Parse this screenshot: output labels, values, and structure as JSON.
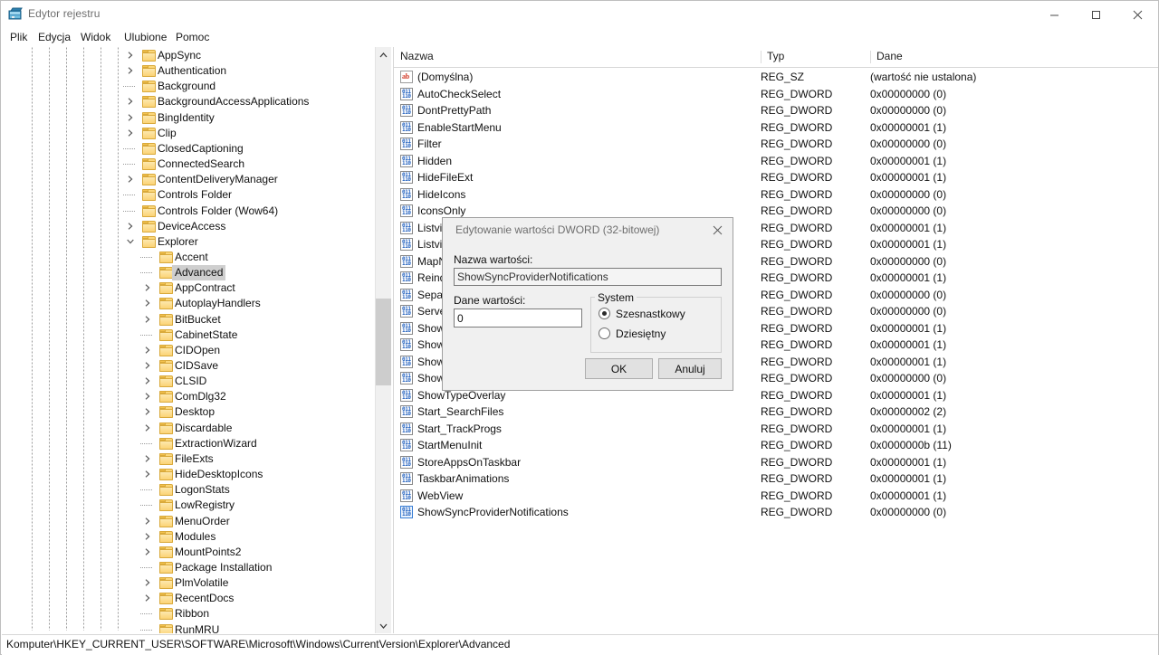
{
  "window": {
    "title": "Edytor rejestru",
    "icon": "registry-editor-icon",
    "minimize": "─",
    "maximize": "□",
    "close": "✕"
  },
  "menu": [
    "Plik",
    "Edycja",
    "Widok",
    "Ulubione",
    "Pomoc"
  ],
  "tree": {
    "items": [
      {
        "label": "AppSync",
        "depth": 5,
        "expander": "collapsed"
      },
      {
        "label": "Authentication",
        "depth": 5,
        "expander": "collapsed"
      },
      {
        "label": "Background",
        "depth": 5,
        "expander": "none"
      },
      {
        "label": "BackgroundAccessApplications",
        "depth": 5,
        "expander": "collapsed"
      },
      {
        "label": "BingIdentity",
        "depth": 5,
        "expander": "collapsed"
      },
      {
        "label": "Clip",
        "depth": 5,
        "expander": "collapsed"
      },
      {
        "label": "ClosedCaptioning",
        "depth": 5,
        "expander": "none"
      },
      {
        "label": "ConnectedSearch",
        "depth": 5,
        "expander": "none"
      },
      {
        "label": "ContentDeliveryManager",
        "depth": 5,
        "expander": "collapsed"
      },
      {
        "label": "Controls Folder",
        "depth": 5,
        "expander": "none"
      },
      {
        "label": "Controls Folder (Wow64)",
        "depth": 5,
        "expander": "none"
      },
      {
        "label": "DeviceAccess",
        "depth": 5,
        "expander": "collapsed"
      },
      {
        "label": "Explorer",
        "depth": 5,
        "expander": "expanded"
      },
      {
        "label": "Accent",
        "depth": 6,
        "expander": "none"
      },
      {
        "label": "Advanced",
        "depth": 6,
        "expander": "none",
        "selected": true
      },
      {
        "label": "AppContract",
        "depth": 6,
        "expander": "collapsed"
      },
      {
        "label": "AutoplayHandlers",
        "depth": 6,
        "expander": "collapsed"
      },
      {
        "label": "BitBucket",
        "depth": 6,
        "expander": "collapsed"
      },
      {
        "label": "CabinetState",
        "depth": 6,
        "expander": "none"
      },
      {
        "label": "CIDOpen",
        "depth": 6,
        "expander": "collapsed"
      },
      {
        "label": "CIDSave",
        "depth": 6,
        "expander": "collapsed"
      },
      {
        "label": "CLSID",
        "depth": 6,
        "expander": "collapsed"
      },
      {
        "label": "ComDlg32",
        "depth": 6,
        "expander": "collapsed"
      },
      {
        "label": "Desktop",
        "depth": 6,
        "expander": "collapsed"
      },
      {
        "label": "Discardable",
        "depth": 6,
        "expander": "collapsed"
      },
      {
        "label": "ExtractionWizard",
        "depth": 6,
        "expander": "none"
      },
      {
        "label": "FileExts",
        "depth": 6,
        "expander": "collapsed"
      },
      {
        "label": "HideDesktopIcons",
        "depth": 6,
        "expander": "collapsed"
      },
      {
        "label": "LogonStats",
        "depth": 6,
        "expander": "none"
      },
      {
        "label": "LowRegistry",
        "depth": 6,
        "expander": "none"
      },
      {
        "label": "MenuOrder",
        "depth": 6,
        "expander": "collapsed"
      },
      {
        "label": "Modules",
        "depth": 6,
        "expander": "collapsed"
      },
      {
        "label": "MountPoints2",
        "depth": 6,
        "expander": "collapsed"
      },
      {
        "label": "Package Installation",
        "depth": 6,
        "expander": "none"
      },
      {
        "label": "PlmVolatile",
        "depth": 6,
        "expander": "collapsed"
      },
      {
        "label": "RecentDocs",
        "depth": 6,
        "expander": "collapsed"
      },
      {
        "label": "Ribbon",
        "depth": 6,
        "expander": "none"
      },
      {
        "label": "RunMRU",
        "depth": 6,
        "expander": "none"
      }
    ]
  },
  "list": {
    "columns": [
      "Nazwa",
      "Typ",
      "Dane"
    ],
    "rows": [
      {
        "name": "(Domyślna)",
        "icon": "reg-sz-icon",
        "type": "REG_SZ",
        "data": "(wartość nie ustalona)"
      },
      {
        "name": "AutoCheckSelect",
        "icon": "reg-dword-icon",
        "type": "REG_DWORD",
        "data": "0x00000000 (0)"
      },
      {
        "name": "DontPrettyPath",
        "icon": "reg-dword-icon",
        "type": "REG_DWORD",
        "data": "0x00000000 (0)"
      },
      {
        "name": "EnableStartMenu",
        "icon": "reg-dword-icon",
        "type": "REG_DWORD",
        "data": "0x00000001 (1)"
      },
      {
        "name": "Filter",
        "icon": "reg-dword-icon",
        "type": "REG_DWORD",
        "data": "0x00000000 (0)"
      },
      {
        "name": "Hidden",
        "icon": "reg-dword-icon",
        "type": "REG_DWORD",
        "data": "0x00000001 (1)"
      },
      {
        "name": "HideFileExt",
        "icon": "reg-dword-icon",
        "type": "REG_DWORD",
        "data": "0x00000001 (1)"
      },
      {
        "name": "HideIcons",
        "icon": "reg-dword-icon",
        "type": "REG_DWORD",
        "data": "0x00000000 (0)"
      },
      {
        "name": "IconsOnly",
        "icon": "reg-dword-icon",
        "type": "REG_DWORD",
        "data": "0x00000000 (0)"
      },
      {
        "name": "Listvie",
        "icon": "reg-dword-icon",
        "type": "REG_DWORD",
        "data": "0x00000001 (1)"
      },
      {
        "name": "Listvie",
        "icon": "reg-dword-icon",
        "type": "REG_DWORD",
        "data": "0x00000001 (1)"
      },
      {
        "name": "MapN",
        "icon": "reg-dword-icon",
        "type": "REG_DWORD",
        "data": "0x00000000 (0)"
      },
      {
        "name": "Reind",
        "icon": "reg-dword-icon",
        "type": "REG_DWORD",
        "data": "0x00000001 (1)"
      },
      {
        "name": "Separ",
        "icon": "reg-dword-icon",
        "type": "REG_DWORD",
        "data": "0x00000000 (0)"
      },
      {
        "name": "Server",
        "icon": "reg-dword-icon",
        "type": "REG_DWORD",
        "data": "0x00000000 (0)"
      },
      {
        "name": "Show",
        "icon": "reg-dword-icon",
        "type": "REG_DWORD",
        "data": "0x00000001 (1)"
      },
      {
        "name": "Showl",
        "icon": "reg-dword-icon",
        "type": "REG_DWORD",
        "data": "0x00000001 (1)"
      },
      {
        "name": "Show",
        "icon": "reg-dword-icon",
        "type": "REG_DWORD",
        "data": "0x00000001 (1)"
      },
      {
        "name": "Show",
        "icon": "reg-dword-icon",
        "type": "REG_DWORD",
        "data": "0x00000000 (0)"
      },
      {
        "name": "ShowTypeOverlay",
        "icon": "reg-dword-icon",
        "type": "REG_DWORD",
        "data": "0x00000001 (1)"
      },
      {
        "name": "Start_SearchFiles",
        "icon": "reg-dword-icon",
        "type": "REG_DWORD",
        "data": "0x00000002 (2)"
      },
      {
        "name": "Start_TrackProgs",
        "icon": "reg-dword-icon",
        "type": "REG_DWORD",
        "data": "0x00000001 (1)"
      },
      {
        "name": "StartMenuInit",
        "icon": "reg-dword-icon",
        "type": "REG_DWORD",
        "data": "0x0000000b (11)"
      },
      {
        "name": "StoreAppsOnTaskbar",
        "icon": "reg-dword-icon",
        "type": "REG_DWORD",
        "data": "0x00000001 (1)"
      },
      {
        "name": "TaskbarAnimations",
        "icon": "reg-dword-icon",
        "type": "REG_DWORD",
        "data": "0x00000001 (1)"
      },
      {
        "name": "WebView",
        "icon": "reg-dword-icon",
        "type": "REG_DWORD",
        "data": "0x00000001 (1)"
      },
      {
        "name": "ShowSyncProviderNotifications",
        "icon": "reg-dword-icon",
        "type": "REG_DWORD",
        "data": "0x00000000 (0)",
        "selected": true
      }
    ]
  },
  "dialog": {
    "title": "Edytowanie wartości DWORD (32-bitowej)",
    "close_icon": "close-icon",
    "name_label": "Nazwa wartości:",
    "name_value": "ShowSyncProviderNotifications",
    "data_label": "Dane wartości:",
    "data_value": "0",
    "group_title": "System",
    "radio_hex": "Szesnastkowy",
    "radio_dec": "Dziesiętny",
    "radio_selected": "hex",
    "ok": "OK",
    "cancel": "Anuluj"
  },
  "status": {
    "path": "Komputer\\HKEY_CURRENT_USER\\SOFTWARE\\Microsoft\\Windows\\CurrentVersion\\Explorer\\Advanced"
  },
  "colors": {
    "selection_gray": "#cfcfcf",
    "folder_yellow": "#fbd77a",
    "dword_blue": "#1f5fbe",
    "sz_red": "#d23a28"
  }
}
